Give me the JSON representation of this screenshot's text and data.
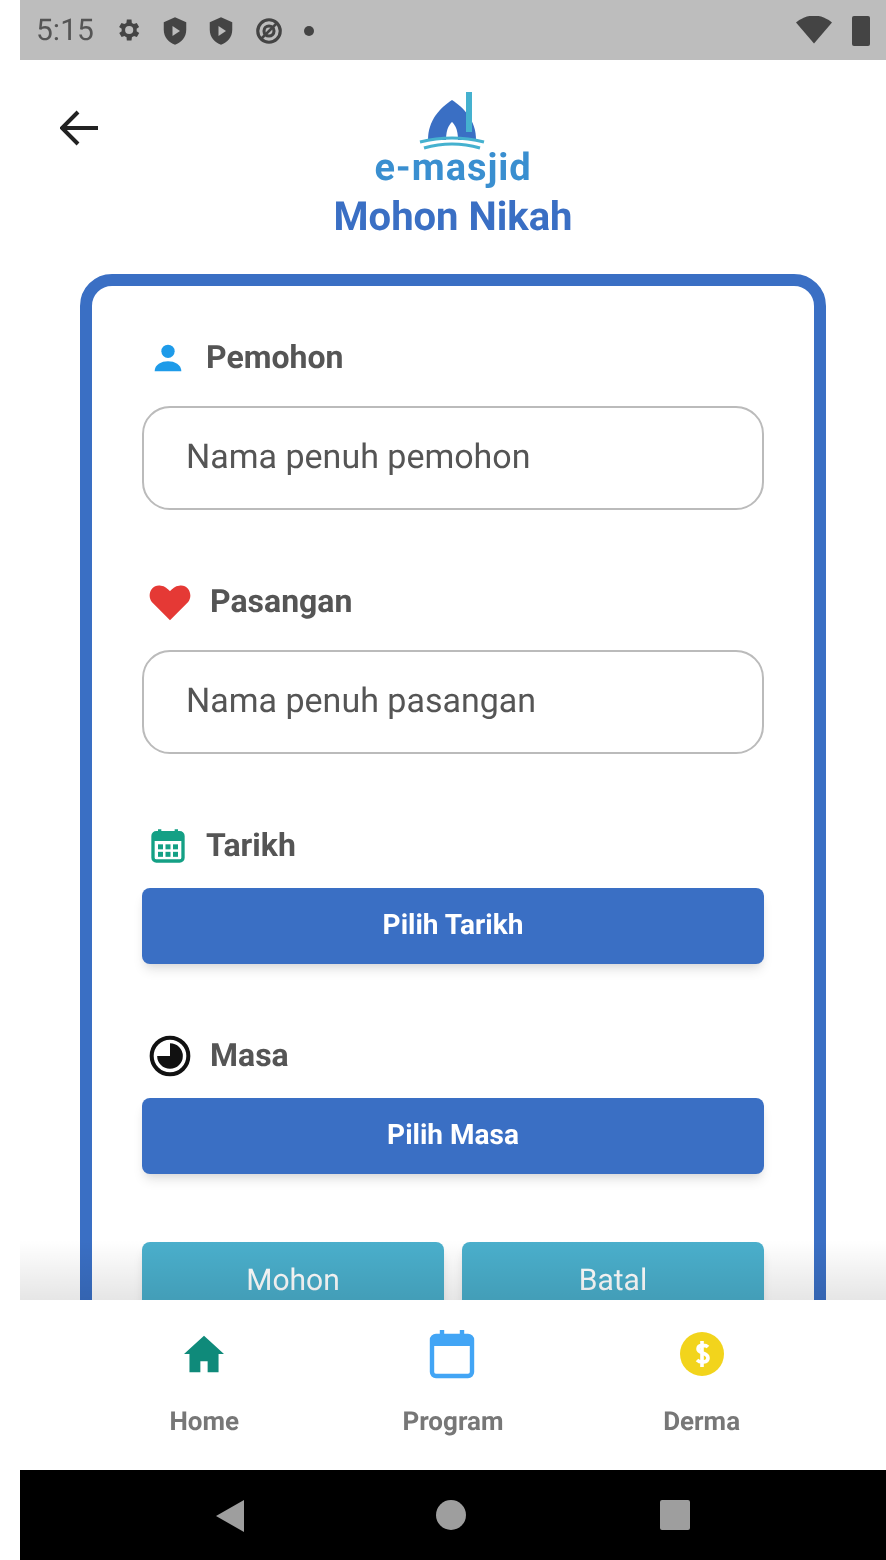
{
  "status_bar": {
    "time": "5:15"
  },
  "header": {
    "logo_text": "e-masjid",
    "title": "Mohon Nikah"
  },
  "fields": [
    {
      "kind": "input",
      "label": "Pemohon",
      "placeholder": "Nama penuh pemohon"
    },
    {
      "kind": "input",
      "label": "Pasangan",
      "placeholder": "Nama penuh pasangan"
    },
    {
      "kind": "button",
      "label": "Tarikh",
      "button": "Pilih Tarikh"
    },
    {
      "kind": "button",
      "label": "Masa",
      "button": "Pilih Masa"
    }
  ],
  "actions": [
    "Mohon",
    "Batal"
  ],
  "bottom_nav": [
    {
      "label": "Home"
    },
    {
      "label": "Program"
    },
    {
      "label": "Derma"
    }
  ]
}
